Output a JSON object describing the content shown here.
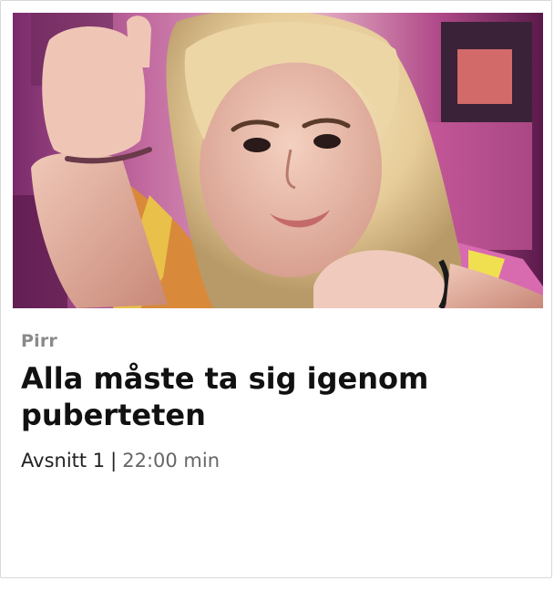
{
  "card": {
    "image_alt": "Young woman with long blonde hair giving a thumbs up in a colorful room",
    "series": "Pirr",
    "title": "Alla måste ta sig igenom puberteten",
    "episode": "Avsnitt 1",
    "separator": "|",
    "duration": "22:00 min"
  },
  "colors": {
    "series_gray": "#8a8a8a",
    "title_black": "#111111",
    "duration_gray": "#666666",
    "border": "#d8d8d8"
  }
}
